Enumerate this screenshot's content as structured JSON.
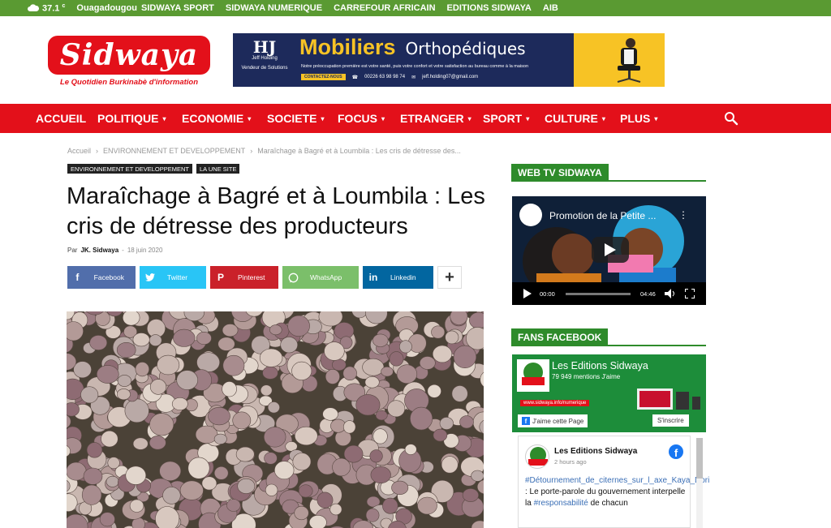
{
  "topbar": {
    "temperature": "37.1",
    "unit": "c",
    "city": "Ouagadougou",
    "links": [
      "SIDWAYA SPORT",
      "SIDWAYA NUMERIQUE",
      "CARREFOUR AFRICAIN",
      "EDITIONS SIDWAYA",
      "AIB"
    ]
  },
  "logo": {
    "name": "Sidwaya",
    "tagline": "Le Quotidien Burkinabè d'information"
  },
  "ad": {
    "brand": "HJ",
    "brand_sub": "Jeff Holding",
    "brand_tag": "Vendeur de Solutions",
    "title_1": "Mobiliers",
    "title_2": "Orthopédiques",
    "subtitle": "Notre préoccupation première est votre santé, puis votre confort et votre satisfaction au bureau comme à la maison",
    "contact_pill": "CONTACTEZ-NOUS",
    "phone": "00226 63 98 98 74",
    "email": "jeff.holding07@gmail.com",
    "colors": {
      "navy": "#1d2a5b",
      "yellow": "#f7c325"
    }
  },
  "nav": {
    "items": [
      {
        "label": "ACCUEIL",
        "caret": ""
      },
      {
        "label": "POLITIQUE",
        "caret": "▾"
      },
      {
        "label": "ECONOMIE",
        "caret": "▾"
      },
      {
        "label": "SOCIETE",
        "caret": "▾"
      },
      {
        "label": "FOCUS",
        "caret": "▾"
      },
      {
        "label": "ETRANGER",
        "caret": "▾"
      },
      {
        "label": "SPORT",
        "caret": "▾"
      },
      {
        "label": "CULTURE",
        "caret": "▾"
      },
      {
        "label": "PLUS",
        "caret": "▾"
      }
    ],
    "search_icon": "search-icon",
    "color": "#e3101a"
  },
  "article": {
    "breadcrumb": [
      "Accueil",
      "›",
      "ENVIRONNEMENT ET DEVELOPPEMENT",
      "›",
      "Maraîchage à Bagré et à Loumbila : Les cris de détresse des..."
    ],
    "tags": [
      "ENVIRONNEMENT ET DEVELOPPEMENT",
      "LA UNE SITE"
    ],
    "title": "Maraîchage à Bagré et à Loumbila : Les cris de détresse des producteurs",
    "by": "Par",
    "author": "JK. Sidwaya",
    "sep": "-",
    "date": "18 juin 2020",
    "share": {
      "facebook": "Facebook",
      "twitter": "Twitter",
      "pinterest": "Pinterest",
      "whatsapp": "WhatsApp",
      "linkedin": "Linkedin",
      "more": "+"
    },
    "image_subject": "onions-photo"
  },
  "sidebar": {
    "webtv_heading": "WEB TV SIDWAYA",
    "video": {
      "title": "Promotion de la Petite ...",
      "current": "00:00",
      "duration": "04:46"
    },
    "fans_heading": "FANS FACEBOOK",
    "fb_page": {
      "name": "Les Editions Sidwaya",
      "mentions": "79 949 mentions J'aime",
      "url": "www.sidwaya.info/numerique",
      "like_label": "J'aime cette Page",
      "join_label": "S'inscrire"
    },
    "post": {
      "author": "Les Editions Sidwaya",
      "time": "2 hours ago",
      "hashtag_1": "#Détournement_de_citernes_sur_l_axe_Kaya_Dori",
      "text_1": " : Le porte-parole du gouvernement interpelle la ",
      "hashtag_2": "#responsabilité",
      "text_2": " de chacun"
    }
  }
}
